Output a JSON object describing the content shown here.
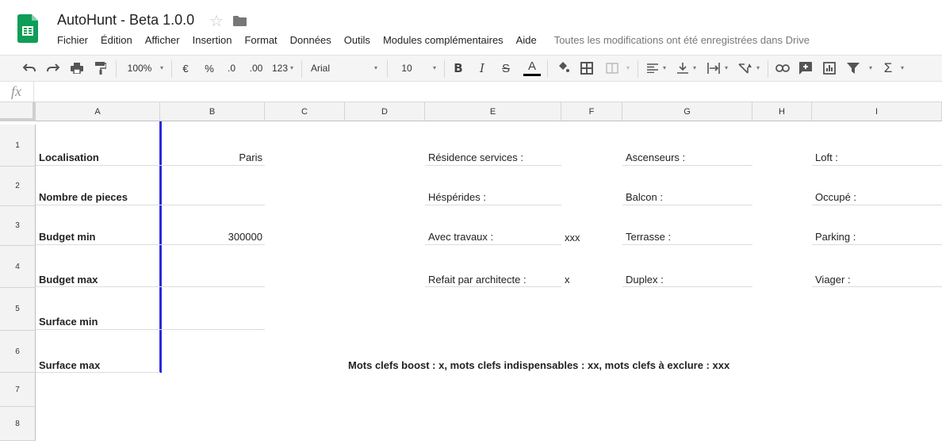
{
  "app": {
    "title": "AutoHunt - Beta 1.0.0",
    "save_status": "Toutes les modifications ont été enregistrées dans Drive",
    "brand_color": "#0f9d58"
  },
  "menu": [
    "Fichier",
    "Édition",
    "Afficher",
    "Insertion",
    "Format",
    "Données",
    "Outils",
    "Modules complémentaires",
    "Aide"
  ],
  "toolbar": {
    "zoom": "100%",
    "currency": "€",
    "percent": "%",
    "decimal_decrease": ".0",
    "decimal_increase": ".00",
    "number_format": "123",
    "font": "Arial",
    "font_size": "10",
    "bold": "B",
    "italic": "I",
    "strike": "S",
    "text_color": "A"
  },
  "formula_bar": {
    "fx": "fx",
    "value": ""
  },
  "columns": [
    "A",
    "B",
    "C",
    "D",
    "E",
    "F",
    "G",
    "H",
    "I"
  ],
  "rows": [
    "1",
    "2",
    "3",
    "4",
    "5",
    "6",
    "7",
    "8"
  ],
  "criteria": [
    {
      "label": "Localisation",
      "value": "Paris"
    },
    {
      "label": "Nombre de pieces",
      "value": ""
    },
    {
      "label": "Budget min",
      "value": "300000"
    },
    {
      "label": "Budget max",
      "value": ""
    },
    {
      "label": "Surface min",
      "value": ""
    },
    {
      "label": "Surface max",
      "value": ""
    }
  ],
  "options_e": [
    {
      "label": "Résidence services :",
      "value": ""
    },
    {
      "label": "Héspérides :",
      "value": ""
    },
    {
      "label": "Avec travaux :",
      "value": "xxx"
    },
    {
      "label": "Refait par architecte :",
      "value": "x"
    }
  ],
  "options_g": [
    "Ascenseurs :",
    "Balcon :",
    "Terrasse :",
    "Duplex :"
  ],
  "options_i": [
    "Loft :",
    "Occupé :",
    "Parking :",
    "Viager :"
  ],
  "legend": "Mots clefs boost : x, mots clefs indispensables : xx, mots clefs à exclure : xxx"
}
